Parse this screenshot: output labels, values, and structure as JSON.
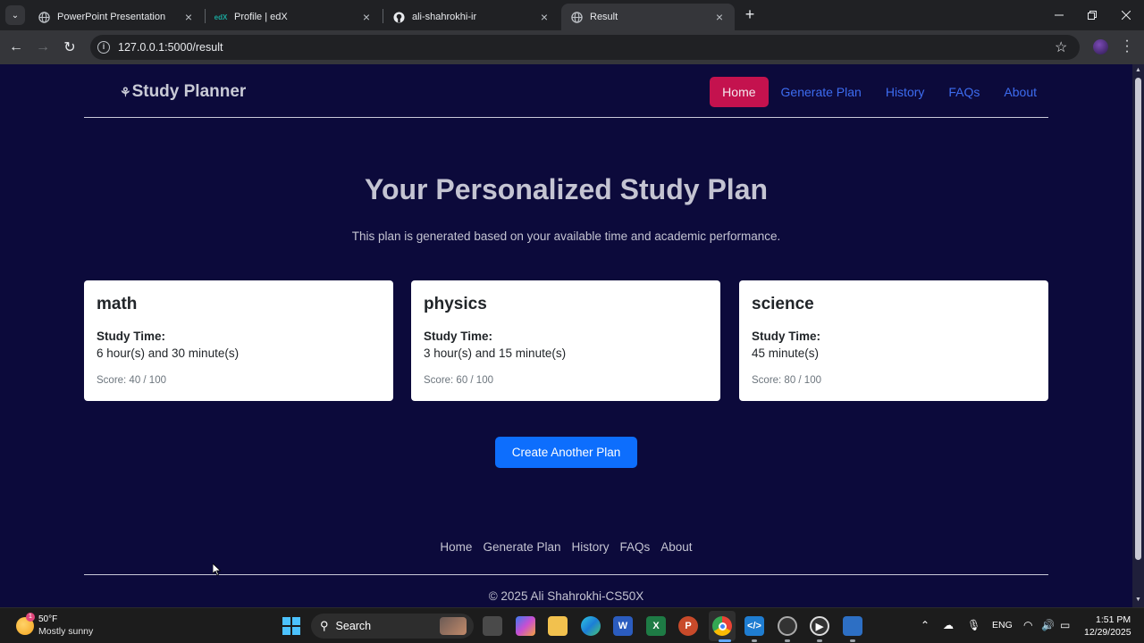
{
  "browser": {
    "tabs": [
      {
        "title": "PowerPoint Presentation",
        "favicon": "globe-icon",
        "active": false
      },
      {
        "title": "Profile | edX",
        "favicon": "edx-icon",
        "active": false
      },
      {
        "title": "ali-shahrokhi-ir",
        "favicon": "github-icon",
        "active": false
      },
      {
        "title": "Result",
        "favicon": "globe-icon",
        "active": true
      }
    ],
    "url": "127.0.0.1:5000/result"
  },
  "site": {
    "brand": "Study Planner",
    "nav": [
      "Home",
      "Generate Plan",
      "History",
      "FAQs",
      "About"
    ],
    "active_nav": "Home",
    "nav_color": "#3d6cf0",
    "active_color": "#c4124e",
    "background": "#0c0a3b"
  },
  "result": {
    "title": "Your Personalized Study Plan",
    "subtitle": "This plan is generated based on your available time and academic performance.",
    "study_time_label": "Study Time:",
    "cards": [
      {
        "subject": "math",
        "time": "6 hour(s) and 30 minute(s)",
        "score": "Score: 40 / 100"
      },
      {
        "subject": "physics",
        "time": "3 hour(s) and 15 minute(s)",
        "score": "Score: 60 / 100"
      },
      {
        "subject": "science",
        "time": "45 minute(s)",
        "score": "Score: 80 / 100"
      }
    ],
    "cta": "Create Another Plan",
    "cta_color": "#0d6efd"
  },
  "footer": {
    "links": [
      "Home",
      "Generate Plan",
      "History",
      "FAQs",
      "About"
    ],
    "copyright": "© 2025 Ali Shahrokhi-CS50X"
  },
  "taskbar": {
    "weather_badge": "1",
    "temp": "50°F",
    "condition": "Mostly sunny",
    "search": "Search",
    "language": "ENG",
    "time": "1:51 PM",
    "date": "12/29/2025"
  }
}
